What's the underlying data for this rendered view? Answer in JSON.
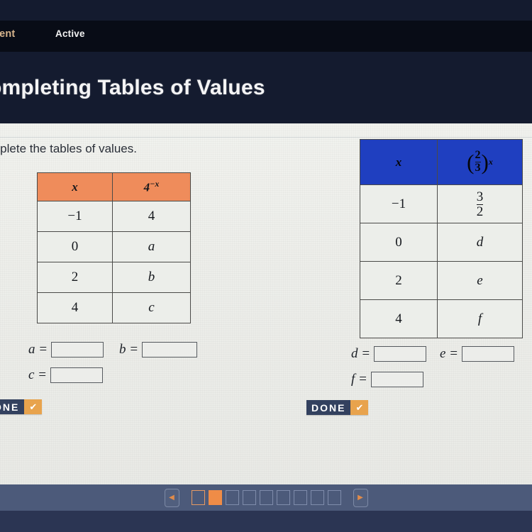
{
  "nav": {
    "breadcrumb_assignment": "ment",
    "tab_active": "Active"
  },
  "header": {
    "title": "ompleting Tables of Values"
  },
  "worksheet": {
    "instruction": "mplete the tables of values.",
    "table_left": {
      "accent_color": "#ef8c5b",
      "headers": [
        "x",
        "4"
      ],
      "header_exponent": "−x",
      "rows": [
        {
          "x": "−1",
          "y": "4"
        },
        {
          "x": "0",
          "y": "a"
        },
        {
          "x": "2",
          "y": "b"
        },
        {
          "x": "4",
          "y": "c"
        }
      ]
    },
    "table_right": {
      "accent_color": "#1f3fc0",
      "headers": [
        "x",
        "(2/3)^x"
      ],
      "header_frac_num": "2",
      "header_frac_den": "3",
      "header_exponent": "x",
      "rows": [
        {
          "x": "−1",
          "y_num": "3",
          "y_den": "2",
          "y": ""
        },
        {
          "x": "0",
          "y": "d"
        },
        {
          "x": "2",
          "y": "e"
        },
        {
          "x": "4",
          "y": "f"
        }
      ]
    },
    "answers_left": [
      {
        "label": "a =",
        "value": ""
      },
      {
        "label": "b =",
        "value": ""
      },
      {
        "label": "c =",
        "value": ""
      }
    ],
    "answers_right": [
      {
        "label": "d =",
        "value": ""
      },
      {
        "label": "e =",
        "value": ""
      },
      {
        "label": "f =",
        "value": ""
      }
    ],
    "done_left": {
      "label": "ONE",
      "check": "✔"
    },
    "done_right": {
      "label": "DONE",
      "check": "✔"
    }
  },
  "pager": {
    "prev_glyph": "◀",
    "next_glyph": "▶",
    "current_index": 2,
    "visited_index": 1,
    "total": 9,
    "accent_color": "#ef8c47"
  }
}
